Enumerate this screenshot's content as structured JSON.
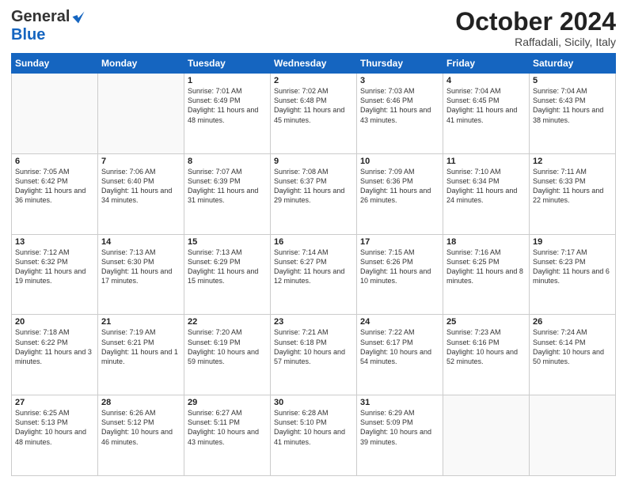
{
  "header": {
    "logo_general": "General",
    "logo_blue": "Blue",
    "month_title": "October 2024",
    "location": "Raffadali, Sicily, Italy"
  },
  "days_of_week": [
    "Sunday",
    "Monday",
    "Tuesday",
    "Wednesday",
    "Thursday",
    "Friday",
    "Saturday"
  ],
  "weeks": [
    [
      {
        "day": "",
        "info": ""
      },
      {
        "day": "",
        "info": ""
      },
      {
        "day": "1",
        "info": "Sunrise: 7:01 AM\nSunset: 6:49 PM\nDaylight: 11 hours and 48 minutes."
      },
      {
        "day": "2",
        "info": "Sunrise: 7:02 AM\nSunset: 6:48 PM\nDaylight: 11 hours and 45 minutes."
      },
      {
        "day": "3",
        "info": "Sunrise: 7:03 AM\nSunset: 6:46 PM\nDaylight: 11 hours and 43 minutes."
      },
      {
        "day": "4",
        "info": "Sunrise: 7:04 AM\nSunset: 6:45 PM\nDaylight: 11 hours and 41 minutes."
      },
      {
        "day": "5",
        "info": "Sunrise: 7:04 AM\nSunset: 6:43 PM\nDaylight: 11 hours and 38 minutes."
      }
    ],
    [
      {
        "day": "6",
        "info": "Sunrise: 7:05 AM\nSunset: 6:42 PM\nDaylight: 11 hours and 36 minutes."
      },
      {
        "day": "7",
        "info": "Sunrise: 7:06 AM\nSunset: 6:40 PM\nDaylight: 11 hours and 34 minutes."
      },
      {
        "day": "8",
        "info": "Sunrise: 7:07 AM\nSunset: 6:39 PM\nDaylight: 11 hours and 31 minutes."
      },
      {
        "day": "9",
        "info": "Sunrise: 7:08 AM\nSunset: 6:37 PM\nDaylight: 11 hours and 29 minutes."
      },
      {
        "day": "10",
        "info": "Sunrise: 7:09 AM\nSunset: 6:36 PM\nDaylight: 11 hours and 26 minutes."
      },
      {
        "day": "11",
        "info": "Sunrise: 7:10 AM\nSunset: 6:34 PM\nDaylight: 11 hours and 24 minutes."
      },
      {
        "day": "12",
        "info": "Sunrise: 7:11 AM\nSunset: 6:33 PM\nDaylight: 11 hours and 22 minutes."
      }
    ],
    [
      {
        "day": "13",
        "info": "Sunrise: 7:12 AM\nSunset: 6:32 PM\nDaylight: 11 hours and 19 minutes."
      },
      {
        "day": "14",
        "info": "Sunrise: 7:13 AM\nSunset: 6:30 PM\nDaylight: 11 hours and 17 minutes."
      },
      {
        "day": "15",
        "info": "Sunrise: 7:13 AM\nSunset: 6:29 PM\nDaylight: 11 hours and 15 minutes."
      },
      {
        "day": "16",
        "info": "Sunrise: 7:14 AM\nSunset: 6:27 PM\nDaylight: 11 hours and 12 minutes."
      },
      {
        "day": "17",
        "info": "Sunrise: 7:15 AM\nSunset: 6:26 PM\nDaylight: 11 hours and 10 minutes."
      },
      {
        "day": "18",
        "info": "Sunrise: 7:16 AM\nSunset: 6:25 PM\nDaylight: 11 hours and 8 minutes."
      },
      {
        "day": "19",
        "info": "Sunrise: 7:17 AM\nSunset: 6:23 PM\nDaylight: 11 hours and 6 minutes."
      }
    ],
    [
      {
        "day": "20",
        "info": "Sunrise: 7:18 AM\nSunset: 6:22 PM\nDaylight: 11 hours and 3 minutes."
      },
      {
        "day": "21",
        "info": "Sunrise: 7:19 AM\nSunset: 6:21 PM\nDaylight: 11 hours and 1 minute."
      },
      {
        "day": "22",
        "info": "Sunrise: 7:20 AM\nSunset: 6:19 PM\nDaylight: 10 hours and 59 minutes."
      },
      {
        "day": "23",
        "info": "Sunrise: 7:21 AM\nSunset: 6:18 PM\nDaylight: 10 hours and 57 minutes."
      },
      {
        "day": "24",
        "info": "Sunrise: 7:22 AM\nSunset: 6:17 PM\nDaylight: 10 hours and 54 minutes."
      },
      {
        "day": "25",
        "info": "Sunrise: 7:23 AM\nSunset: 6:16 PM\nDaylight: 10 hours and 52 minutes."
      },
      {
        "day": "26",
        "info": "Sunrise: 7:24 AM\nSunset: 6:14 PM\nDaylight: 10 hours and 50 minutes."
      }
    ],
    [
      {
        "day": "27",
        "info": "Sunrise: 6:25 AM\nSunset: 5:13 PM\nDaylight: 10 hours and 48 minutes."
      },
      {
        "day": "28",
        "info": "Sunrise: 6:26 AM\nSunset: 5:12 PM\nDaylight: 10 hours and 46 minutes."
      },
      {
        "day": "29",
        "info": "Sunrise: 6:27 AM\nSunset: 5:11 PM\nDaylight: 10 hours and 43 minutes."
      },
      {
        "day": "30",
        "info": "Sunrise: 6:28 AM\nSunset: 5:10 PM\nDaylight: 10 hours and 41 minutes."
      },
      {
        "day": "31",
        "info": "Sunrise: 6:29 AM\nSunset: 5:09 PM\nDaylight: 10 hours and 39 minutes."
      },
      {
        "day": "",
        "info": ""
      },
      {
        "day": "",
        "info": ""
      }
    ]
  ]
}
